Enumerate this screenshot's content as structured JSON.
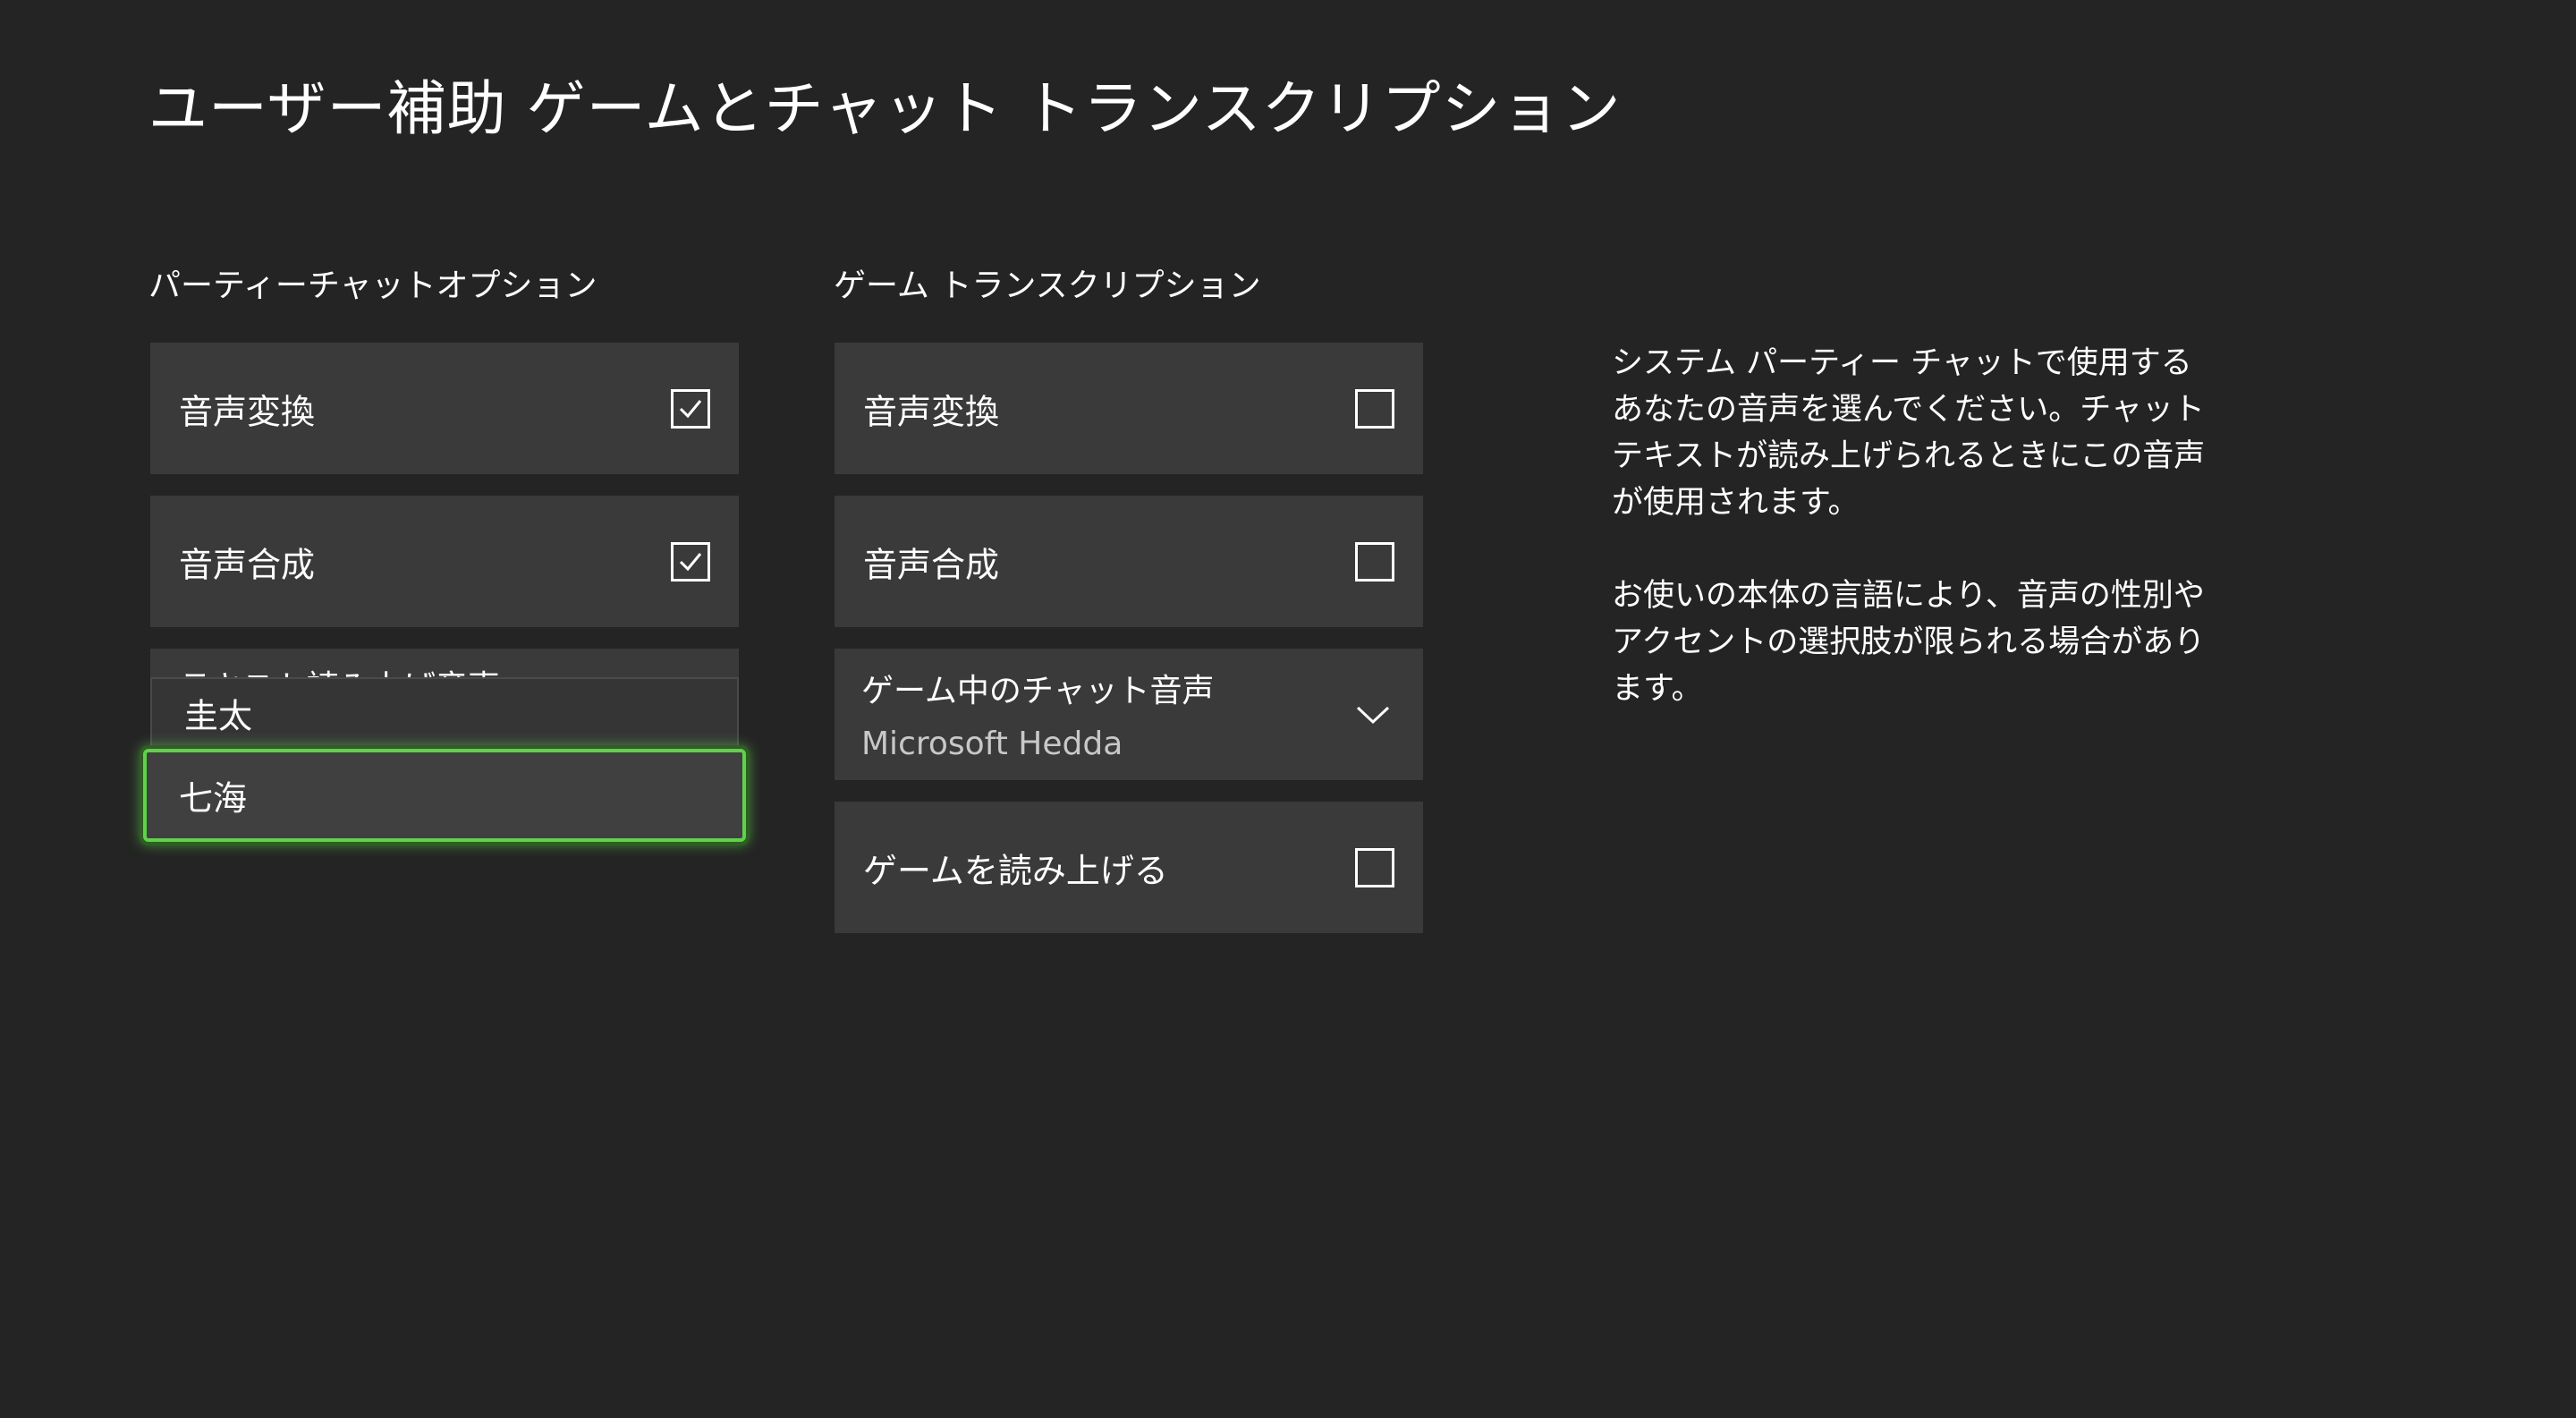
{
  "header": {
    "title": "ユーザー補助  ゲームとチャット トランスクリプション"
  },
  "party_chat": {
    "section_title": "パーティーチャットオプション",
    "speech_to_text": {
      "label": "音声変換",
      "checked": true
    },
    "text_to_speech": {
      "label": "音声合成",
      "checked": true
    },
    "tts_voice_label": "テキスト読み上げ音声",
    "voice_options": [
      "圭太",
      "七海"
    ],
    "focused_option": "七海"
  },
  "game_transcription": {
    "section_title": "ゲーム トランスクリプション",
    "speech_to_text": {
      "label": "音声変換",
      "checked": false
    },
    "text_to_speech": {
      "label": "音声合成",
      "checked": false
    },
    "chat_voice": {
      "label": "ゲーム中のチャット音声",
      "value": "Microsoft Hedda"
    },
    "read_game": {
      "label": "ゲームを読み上げる",
      "checked": false
    }
  },
  "description": {
    "paragraph1": "システム パーティー チャットで使用するあなたの音声を選んでください。チャット テキストが読み上げられるときにこの音声が使用されます。",
    "paragraph2": "お使いの本体の言語により、音声の性別やアクセントの選択肢が限られる場合があります。"
  },
  "colors": {
    "background": "#242424",
    "tile": "#3a3a3a",
    "focus_accent": "#5fd24a"
  }
}
